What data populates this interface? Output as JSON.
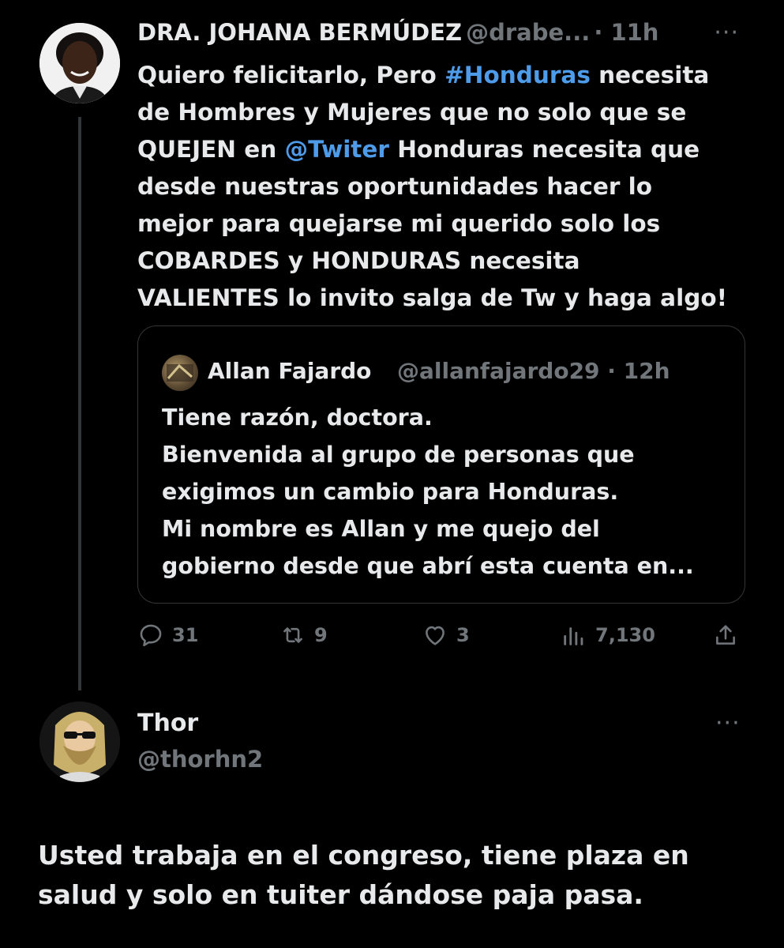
{
  "tweet": {
    "author": {
      "name": "DRA. JOHANA BERMÚDEZ",
      "handle": "@drabe...",
      "time": "· 11h"
    },
    "more_label": "···",
    "text": {
      "l1_pre": "Quiero felicitarlo, Pero ",
      "l1_tag": "#Honduras",
      "l1_post": " necesita",
      "l2": "de Hombres y Mujeres que no solo que se",
      "l3_pre": "QUEJEN en ",
      "l3_mention": "@Twiter",
      "l3_post": " Honduras necesita que",
      "l4": "desde nuestras oportunidades hacer lo",
      "l5": "mejor para quejarse mi querido  solo los",
      "l6": "COBARDES y HONDURAS necesita",
      "l7": "VALIENTES lo invito salga de Tw y haga algo!"
    },
    "quote": {
      "name": "Allan Fajardo",
      "handle": "@allanfajardo29 · 12h",
      "lines": [
        "Tiene razón, doctora.",
        "Bienvenida al grupo de personas que",
        "exigimos un cambio para Honduras.",
        "Mi nombre es Allan y me quejo del",
        "gobierno desde que abrí esta cuenta en..."
      ]
    },
    "actions": {
      "replies": "31",
      "retweets": "9",
      "likes": "3",
      "views": "7,130"
    }
  },
  "reply": {
    "name": "Thor",
    "handle": "@thorhn2",
    "more_label": "···",
    "lines": [
      "Usted trabaja en el congreso, tiene plaza en",
      "salud y solo en tuiter dándose paja pasa."
    ]
  },
  "colors": {
    "background": "#000000",
    "text": "#e7e9ea",
    "muted": "#71767b",
    "link": "#4d9be9",
    "border": "#333639"
  },
  "icons": [
    "reply-icon",
    "retweet-icon",
    "like-icon",
    "views-icon",
    "share-icon",
    "more-icon"
  ]
}
